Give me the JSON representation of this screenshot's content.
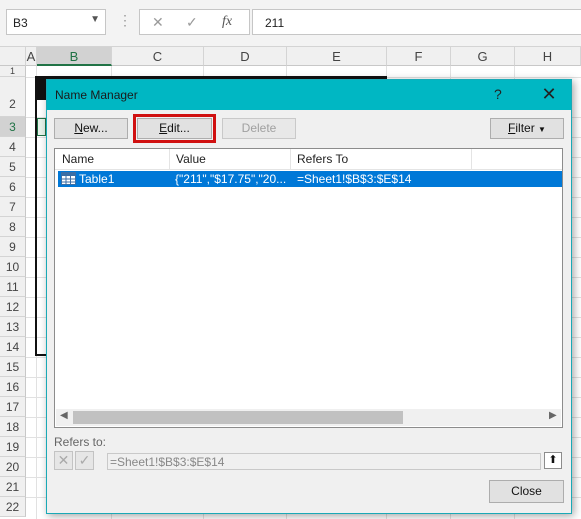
{
  "formula_bar": {
    "name_box": "B3",
    "cancel_glyph": "✕",
    "enter_glyph": "✓",
    "fx_glyph": "fx",
    "formula_value": "211"
  },
  "sheet": {
    "columns": [
      "A",
      "B",
      "C",
      "D",
      "E",
      "F",
      "G",
      "H"
    ],
    "rows": [
      "1",
      "2",
      "3",
      "4",
      "5",
      "6",
      "7",
      "8",
      "9",
      "10",
      "11",
      "12",
      "13",
      "14",
      "15",
      "16",
      "17",
      "18",
      "19",
      "20",
      "21",
      "22"
    ],
    "selected_column": "B",
    "selected_row": "3"
  },
  "dialog": {
    "title": "Name Manager",
    "help_glyph": "?",
    "close_glyph": "✕",
    "buttons": {
      "new": "New...",
      "edit": "Edit...",
      "delete": "Delete",
      "filter": "Filter",
      "close": "Close"
    },
    "list": {
      "columns": [
        "Name",
        "Value",
        "Refers To"
      ],
      "rows": [
        {
          "name": "Table1",
          "value": "{\"211\",\"$17.75\",\"20...",
          "refers_to": "=Sheet1!$B$3:$E$14"
        }
      ]
    },
    "refers_to": {
      "label": "Refers to:",
      "value": "=Sheet1!$B$3:$E$14"
    }
  },
  "colors": {
    "title_bar": "#00b7c3",
    "selection": "#0078d7",
    "highlight": "#d01010",
    "excel_green": "#217346"
  }
}
